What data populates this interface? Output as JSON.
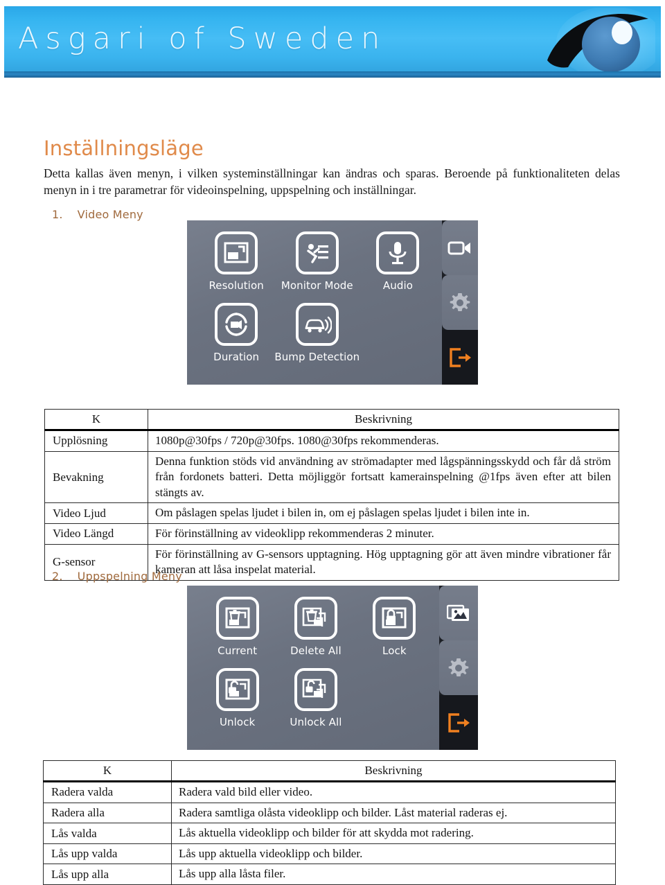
{
  "header": {
    "brand": "Asgari of Sweden",
    "logo_icon": "eye-icon"
  },
  "document": {
    "title": "Inställningsläge",
    "intro": "Detta kallas även menyn, i vilken systeminställningar kan ändras och sparas. Beroende på funktionaliteten delas menyn in i tre parametrar för videoinspelning, uppspelning och inställningar.",
    "sections": [
      {
        "number": "1.",
        "label": "Video Meny"
      },
      {
        "number": "2.",
        "label": "Uppspelning Meny"
      }
    ]
  },
  "video_menu_screenshot": {
    "tiles": [
      {
        "label": "Resolution",
        "icon": "resolution-icon"
      },
      {
        "label": "Monitor Mode",
        "icon": "monitor-mode-icon"
      },
      {
        "label": "Audio",
        "icon": "microphone-icon"
      },
      {
        "label": "Duration",
        "icon": "duration-loop-icon"
      },
      {
        "label": "Bump Detection",
        "icon": "car-bump-icon"
      }
    ],
    "rail": [
      {
        "icon": "video-camera-icon",
        "state": "active"
      },
      {
        "icon": "gear-icon",
        "state": "inactive"
      },
      {
        "icon": "exit-arrow-icon",
        "state": "exit"
      }
    ]
  },
  "playback_menu_screenshot": {
    "tiles": [
      {
        "label": "Current",
        "icon": "delete-current-icon"
      },
      {
        "label": "Delete All",
        "icon": "delete-all-icon"
      },
      {
        "label": "Lock",
        "icon": "lock-icon"
      },
      {
        "label": "Unlock",
        "icon": "unlock-icon"
      },
      {
        "label": "Unlock All",
        "icon": "unlock-all-icon"
      }
    ],
    "rail": [
      {
        "icon": "gallery-icon",
        "state": "active"
      },
      {
        "icon": "gear-icon",
        "state": "inactive"
      },
      {
        "icon": "exit-arrow-icon",
        "state": "exit"
      }
    ]
  },
  "table_video": {
    "headers": [
      "K",
      "Beskrivning"
    ],
    "rows": [
      {
        "key": "Upplösning",
        "desc": "1080p@30fps / 720p@30fps. 1080@30fps rekommenderas."
      },
      {
        "key": "Bevakning",
        "desc": "Denna funktion stöds vid användning av strömadapter med lågspänningsskydd och får då ström från fordonets batteri. Detta möjliggör fortsatt kamerainspelning @1fps även efter att bilen stängts av."
      },
      {
        "key": "Video Ljud",
        "desc": "Om påslagen spelas ljudet i bilen in, om ej påslagen spelas ljudet i bilen inte in."
      },
      {
        "key": "Video Längd",
        "desc": "För förinställning av videoklipp rekommenderas 2 minuter."
      },
      {
        "key": "G-sensor",
        "desc": "För förinställning av G-sensors upptagning. Hög upptagning gör att även mindre vibrationer får kameran att låsa inspelat material."
      }
    ]
  },
  "table_playback": {
    "headers": [
      "K",
      "Beskrivning"
    ],
    "rows": [
      {
        "key": "Radera valda",
        "desc": "Radera vald bild eller video."
      },
      {
        "key": "Radera alla",
        "desc": "Radera samtliga olåsta videoklipp och bilder. Låst material raderas ej."
      },
      {
        "key": "Lås valda",
        "desc": "Lås aktuella videoklipp och bilder för att skydda mot radering."
      },
      {
        "key": "Lås upp valda",
        "desc": "Lås upp aktuella videoklipp och bilder."
      },
      {
        "key": "Lås upp alla",
        "desc": "Lås upp alla låsta filer."
      }
    ]
  },
  "colors": {
    "banner_blue": "#3ab3ee",
    "banner_edge": "#1d6fa8",
    "title_orange": "#e08a4a",
    "list_brown": "#a06a3d",
    "device_gray": "#6d7483",
    "device_rail_dark": "#1c1f25",
    "exit_orange": "#f08020"
  }
}
